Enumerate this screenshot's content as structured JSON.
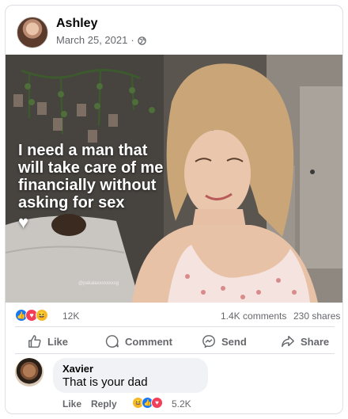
{
  "post": {
    "author": "Ashley",
    "date": "March 25, 2021",
    "separator": "·",
    "privacy_icon": "globe-icon",
    "image": {
      "caption": "I need a man that will take care of me financially without asking for sex",
      "heart": "♥",
      "watermark": "@pakalaxxxxxxxsg"
    }
  },
  "reactions": {
    "icons": [
      "like-reaction-icon",
      "love-reaction-icon",
      "haha-reaction-icon"
    ],
    "count": "12K",
    "comments": "1.4K comments",
    "shares": "230 shares"
  },
  "actions": {
    "like": "Like",
    "comment": "Comment",
    "send": "Send",
    "share": "Share"
  },
  "comment": {
    "author": "Xavier",
    "text": "That is your dad",
    "like": "Like",
    "reply": "Reply",
    "reaction_icons": [
      "haha-reaction-icon",
      "like-reaction-icon",
      "love-reaction-icon"
    ],
    "reaction_count": "5.2K"
  },
  "colors": {
    "brand_blue": "#1877f2",
    "love_red": "#f33e58",
    "haha_yellow": "#f7b928",
    "secondary_text": "#65676b"
  }
}
